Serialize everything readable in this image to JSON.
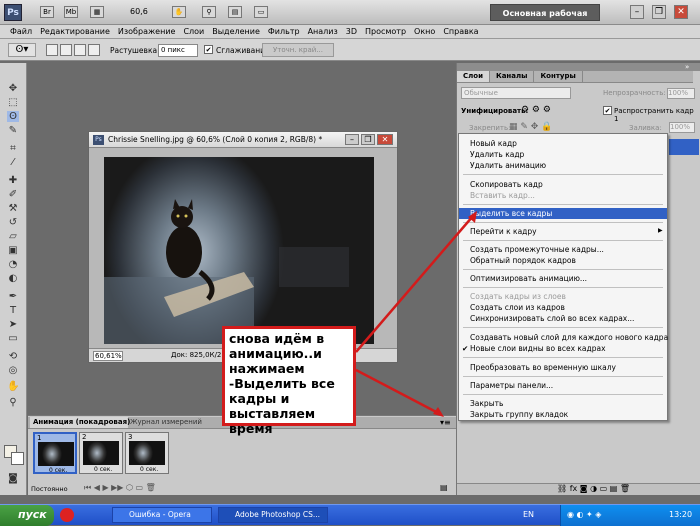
{
  "app": {
    "logo": "Ps",
    "br_label": "Br",
    "mb_label": "Mb",
    "zoom": "60,6",
    "workspace": "Основная рабочая среда"
  },
  "menu": [
    "Файл",
    "Редактирование",
    "Изображение",
    "Слои",
    "Выделение",
    "Фильтр",
    "Анализ",
    "3D",
    "Просмотр",
    "Окно",
    "Справка"
  ],
  "options": {
    "feather_label": "Растушевка:",
    "feather_value": "0 пикс",
    "antialias": "Сглаживание",
    "refine": "Уточн. край..."
  },
  "document": {
    "title": "Chrissie Snelling.jpg @ 60,6% (Слой 0 копия 2, RGB/8) *",
    "zoom": "60,61%",
    "doc_info": "Док: 825,0К/2,42"
  },
  "layers_panel": {
    "tabs": [
      "Слои",
      "Каналы",
      "Контуры"
    ],
    "blend": "Обычные",
    "opacity_label": "Непрозрачность:",
    "opacity": "100%",
    "unify": "Унифицировать:",
    "propagate": "Распространить кадр 1",
    "lock": "Закрепить:",
    "fill_label": "Заливка:",
    "fill": "100%"
  },
  "context_menu": {
    "items": [
      {
        "label": "Новый кадр",
        "state": "normal"
      },
      {
        "label": "Удалить кадр",
        "state": "normal"
      },
      {
        "label": "Удалить анимацию",
        "state": "normal"
      },
      {
        "label": "Скопировать кадр",
        "state": "normal"
      },
      {
        "label": "Вставить кадр...",
        "state": "disabled"
      },
      {
        "label": "Выделить все кадры",
        "state": "highlighted"
      },
      {
        "label": "Перейти к кадру",
        "state": "normal"
      },
      {
        "label": "Создать промежуточные кадры...",
        "state": "normal"
      },
      {
        "label": "Обратный порядок кадров",
        "state": "normal"
      },
      {
        "label": "Оптимизировать анимацию...",
        "state": "normal"
      },
      {
        "label": "Создать кадры из слоев",
        "state": "disabled"
      },
      {
        "label": "Создать слои из кадров",
        "state": "normal"
      },
      {
        "label": "Синхронизировать слой во всех кадрах...",
        "state": "normal"
      },
      {
        "label": "Создавать новый слой для каждого нового кадра",
        "state": "normal"
      },
      {
        "label": "Новые слои видны во всех кадрах",
        "state": "checked"
      },
      {
        "label": "Преобразовать во временную шкалу",
        "state": "normal"
      },
      {
        "label": "Параметры панели...",
        "state": "normal"
      },
      {
        "label": "Закрыть",
        "state": "normal"
      },
      {
        "label": "Закрыть группу вкладок",
        "state": "normal"
      }
    ],
    "submenu_arrow": "▶",
    "checkmark": "✔"
  },
  "animation_panel": {
    "tabs": [
      "Анимация (покадровая)",
      "Журнал измерений"
    ],
    "frames": [
      {
        "number": "1",
        "delay": "0 сек."
      },
      {
        "number": "2",
        "delay": "0 сек."
      },
      {
        "number": "3",
        "delay": "0 сек."
      }
    ],
    "loop": "Постоянно"
  },
  "annotation": {
    "text": "снова идём в\nанимацию..и\nнажимаем\n-Выделить все\nкадры и\nвыставляем время"
  },
  "taskbar": {
    "start": "пуск",
    "tasks": [
      "Ошибка - Opera",
      "Adobe Photoshop CS..."
    ],
    "lang": "EN",
    "time": "13:20"
  },
  "colors": {
    "highlight": "#3161c5",
    "annotation_border": "#d31b1b",
    "taskbar": "#2458d4"
  }
}
